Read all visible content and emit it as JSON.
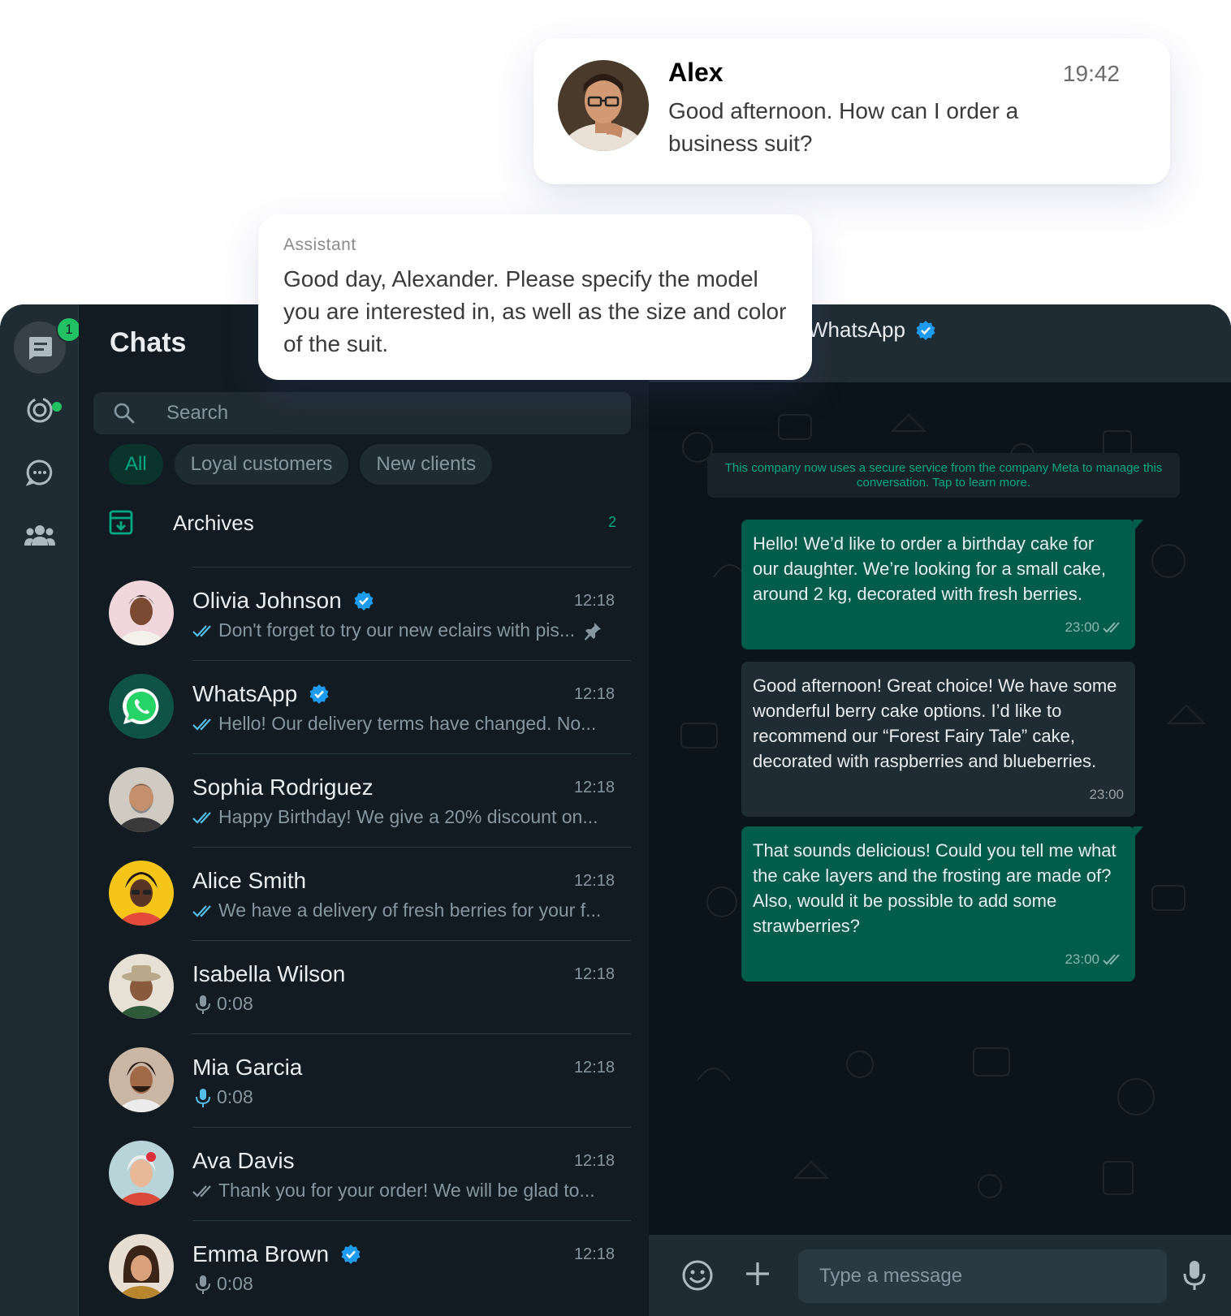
{
  "colors": {
    "accent": "#00a884",
    "badge": "#21c063",
    "outgoing_bubble": "#005c4b",
    "incoming_bubble": "#202c33",
    "check_read": "#53bdeb",
    "verified": "#1d9bf0"
  },
  "popups": {
    "customer": {
      "name": "Alex",
      "time": "19:42",
      "message": "Good afternoon. How can I order a business suit?"
    },
    "assistant": {
      "role": "Assistant",
      "message": "Good day, Alexander. Please specify the model you are interested in, as well as the size and color of the suit."
    }
  },
  "rail": {
    "chats_badge": "1",
    "items": [
      "chats-icon",
      "status-icon",
      "channels-icon",
      "communities-icon"
    ]
  },
  "list": {
    "title": "Chats",
    "search_placeholder": "Search",
    "filters": [
      "All",
      "Loyal customers",
      "New clients"
    ],
    "archives": {
      "label": "Archives",
      "count": "2"
    },
    "chats": [
      {
        "name": "Olivia Johnson",
        "verified": true,
        "time": "12:18",
        "preview": "Don't forget to try our new eclairs with pis...",
        "type": "text",
        "pinned": true
      },
      {
        "name": "WhatsApp",
        "verified": true,
        "time": "12:18",
        "preview": "Hello! Our delivery terms have changed. No...",
        "type": "text",
        "pinned": false
      },
      {
        "name": "Sophia Rodriguez",
        "verified": false,
        "time": "12:18",
        "preview": "Happy Birthday! We give a 20% discount on...",
        "type": "text",
        "pinned": false
      },
      {
        "name": "Alice Smith",
        "verified": false,
        "time": "12:18",
        "preview": "We have a delivery of fresh berries for your f...",
        "type": "text",
        "pinned": false
      },
      {
        "name": "Isabella Wilson",
        "verified": false,
        "time": "12:18",
        "preview": "0:08",
        "type": "voice",
        "pinned": false
      },
      {
        "name": "Mia Garcia",
        "verified": false,
        "time": "12:18",
        "preview": "0:08",
        "type": "voice",
        "pinned": false
      },
      {
        "name": "Ava Davis",
        "verified": false,
        "time": "12:18",
        "preview": "Thank you for your order! We will be glad to...",
        "type": "text-grey",
        "pinned": false
      },
      {
        "name": "Emma Brown",
        "verified": true,
        "time": "12:18",
        "preview": "0:08",
        "type": "voice",
        "pinned": false
      }
    ]
  },
  "conversation": {
    "title": "WhatsApp",
    "system_note": "This company now uses a secure service from the company Meta to manage this conversation. Tap to learn more.",
    "messages": [
      {
        "direction": "out",
        "text": "Hello! We’d like to order a birthday cake for our daughter. We’re looking for a small cake, around 2 kg, decorated with fresh berries.",
        "time": "23:00"
      },
      {
        "direction": "in",
        "text": "Good afternoon! Great choice! We have some wonderful berry cake options. I’d like to recommend our “Forest Fairy Tale” cake, decorated with raspberries and blueberries.",
        "time": "23:00"
      },
      {
        "direction": "out",
        "text": "That sounds delicious! Could you tell me what the cake layers and the frosting are made of? Also, would it be possible to add some strawberries?",
        "time": "23:00"
      }
    ],
    "composer_placeholder": "Type a message"
  }
}
